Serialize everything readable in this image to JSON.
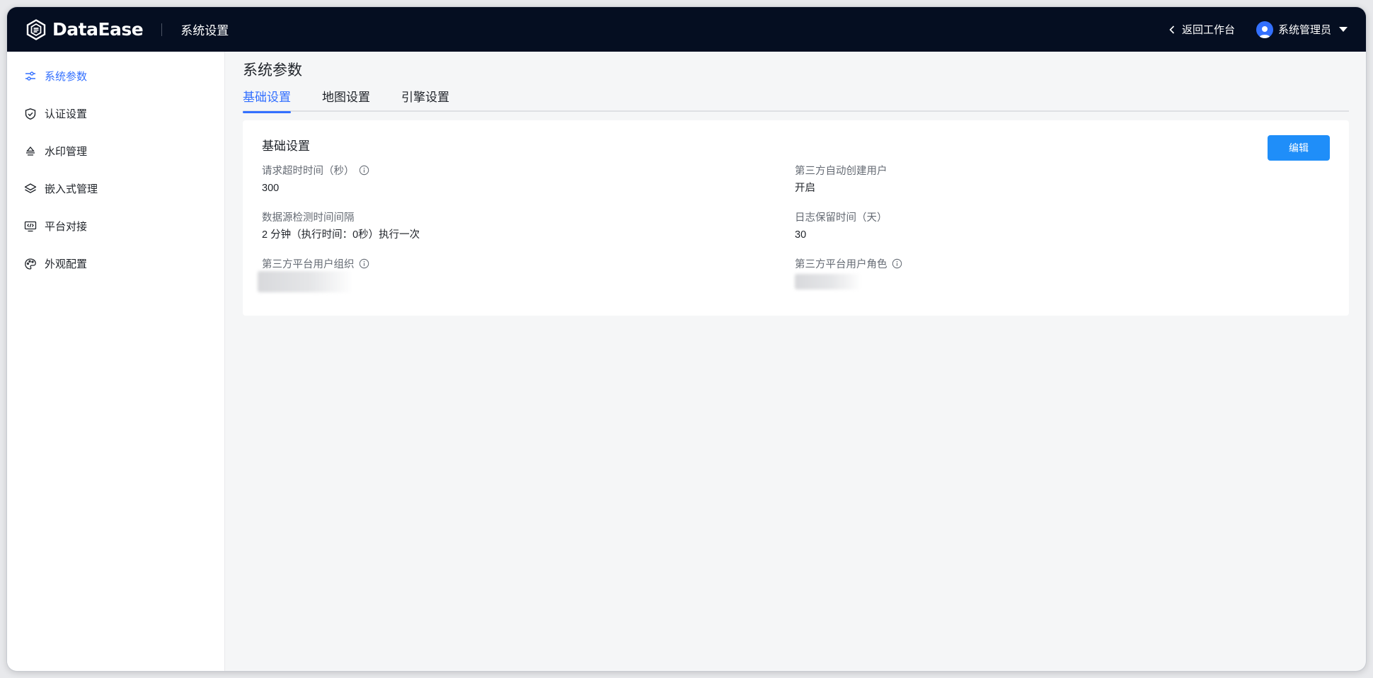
{
  "header": {
    "brand": "DataEase",
    "section_title": "系统设置",
    "back_label": "返回工作台",
    "user_name": "系统管理员"
  },
  "sidebar": {
    "items": [
      {
        "label": "系统参数",
        "icon": "sliders-icon",
        "active": true
      },
      {
        "label": "认证设置",
        "icon": "shield-check-icon",
        "active": false
      },
      {
        "label": "水印管理",
        "icon": "watermark-icon",
        "active": false
      },
      {
        "label": "嵌入式管理",
        "icon": "layers-icon",
        "active": false
      },
      {
        "label": "平台对接",
        "icon": "monitor-code-icon",
        "active": false
      },
      {
        "label": "外观配置",
        "icon": "palette-icon",
        "active": false
      }
    ]
  },
  "main": {
    "page_title": "系统参数",
    "tabs": [
      {
        "label": "基础设置",
        "active": true
      },
      {
        "label": "地图设置",
        "active": false
      },
      {
        "label": "引擎设置",
        "active": false
      }
    ],
    "card": {
      "title": "基础设置",
      "edit_label": "编辑",
      "fields": [
        {
          "label": "请求超时时间（秒）",
          "value": "300",
          "info": true
        },
        {
          "label": "第三方自动创建用户",
          "value": "开启",
          "info": false
        },
        {
          "label": "数据源检测时间间隔",
          "value": "2 分钟（执行时间：0秒）执行一次",
          "info": false
        },
        {
          "label": "日志保留时间（天）",
          "value": "30",
          "info": false
        },
        {
          "label": "第三方平台用户组织",
          "value": "",
          "info": true,
          "redacted": true
        },
        {
          "label": "第三方平台用户角色",
          "value": "",
          "info": true,
          "redacted": true
        }
      ]
    }
  },
  "colors": {
    "header_bg": "#050e21",
    "accent": "#3370ff",
    "button": "#1f8ef9",
    "page_bg": "#f5f6f7"
  }
}
